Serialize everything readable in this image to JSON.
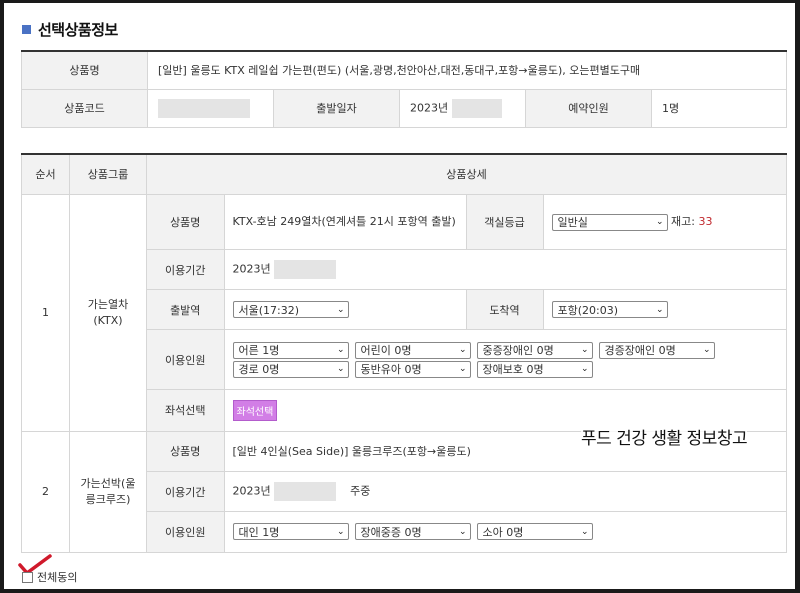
{
  "section_title": "선택상품정보",
  "product": {
    "name_label": "상품명",
    "name_value": "[일반] 울릉도 KTX 레일쉽 가는편(편도) (서울,광명,천안아산,대전,동대구,포항→울릉도), 오는편별도구매",
    "code_label": "상품코드",
    "departure_date_label": "출발일자",
    "departure_date_value": "2023년",
    "people_label": "예약인원",
    "people_value": "1명"
  },
  "detail_table": {
    "col_seq": "순서",
    "col_group": "상품그룹",
    "col_detail": "상품상세"
  },
  "train": {
    "seq": "1",
    "group": "가는열차\n(KTX)",
    "name_label": "상품명",
    "name_value": "KTX-호남 249열차(연계셔틀 21시 포항역 출발)",
    "class_label": "객실등급",
    "class_value": "일반실",
    "stock_label": "재고:",
    "stock_value": "33",
    "period_label": "이용기간",
    "period_value": "2023년",
    "depart_station_label": "출발역",
    "depart_station_value": "서울(17:32)",
    "arrive_station_label": "도착역",
    "arrive_station_value": "포항(20:03)",
    "people_label": "이용인원",
    "people_selects": [
      "어른 1명",
      "어린이 0명",
      "중증장애인 0명",
      "경증장애인 0명",
      "경로 0명",
      "동반유아 0명",
      "장애보호 0명"
    ],
    "seat_label": "좌석선택",
    "seat_button": "좌석선택"
  },
  "ship": {
    "seq": "2",
    "group": "가는선박(울릉크루즈)",
    "name_label": "상품명",
    "name_value": "[일반 4인실(Sea Side)] 울릉크루즈(포항→울릉도)",
    "period_label": "이용기간",
    "period_value": "2023년",
    "period_suffix": "주중",
    "people_label": "이용인원",
    "people_selects": [
      "대인 1명",
      "장애중증 0명",
      "소아 0명"
    ]
  },
  "watermark": "푸드 건강 생활 정보창고",
  "agree_all": "전체동의",
  "colors": {
    "accent_square": "#4a72c4",
    "stock": "#c0282d",
    "seat_button": "#d27ee6",
    "check_mark": "#d0192b"
  }
}
